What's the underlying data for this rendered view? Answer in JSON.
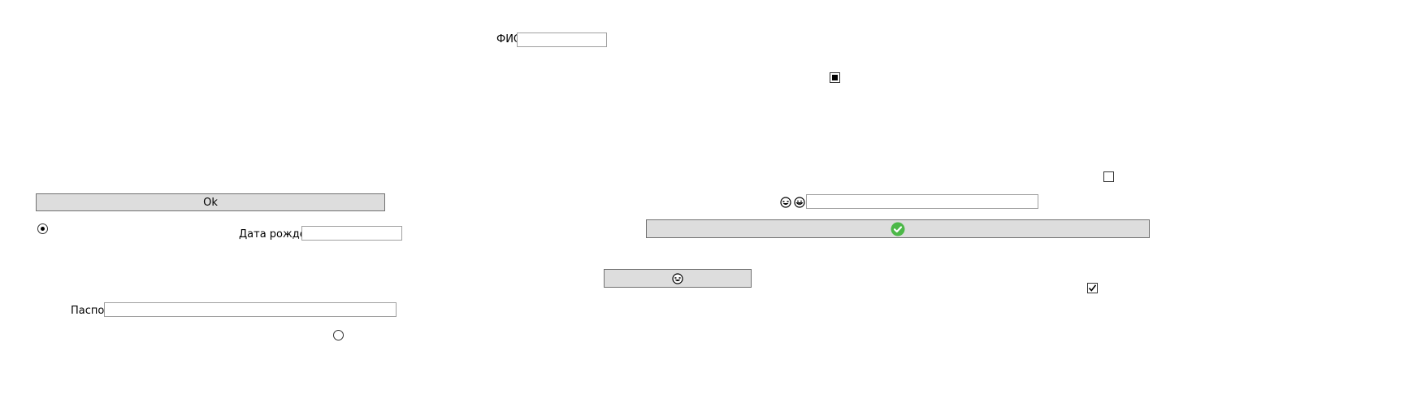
{
  "fio": {
    "label": "ФИО",
    "value": ""
  },
  "birth_date": {
    "label": "Дата рождения",
    "value": ""
  },
  "passport": {
    "label": "Паспорт",
    "value": ""
  },
  "ok_button": {
    "label": "Ok"
  },
  "emoji_field": {
    "value": "",
    "icons": [
      "laughing-face-icon",
      "grinning-face-icon"
    ]
  },
  "confirm_button": {
    "icon": "green-check-icon",
    "color": "#4cb848"
  },
  "emoji_button": {
    "icon": "laughing-face-icon"
  },
  "radios": [
    {
      "name": "radio-option-1",
      "checked": true
    },
    {
      "name": "radio-option-2",
      "checked": false
    }
  ],
  "checkboxes": [
    {
      "name": "checkbox-indeterminate",
      "state": "indeterminate"
    },
    {
      "name": "checkbox-unchecked",
      "state": "unchecked"
    },
    {
      "name": "checkbox-checked",
      "state": "checked"
    }
  ]
}
